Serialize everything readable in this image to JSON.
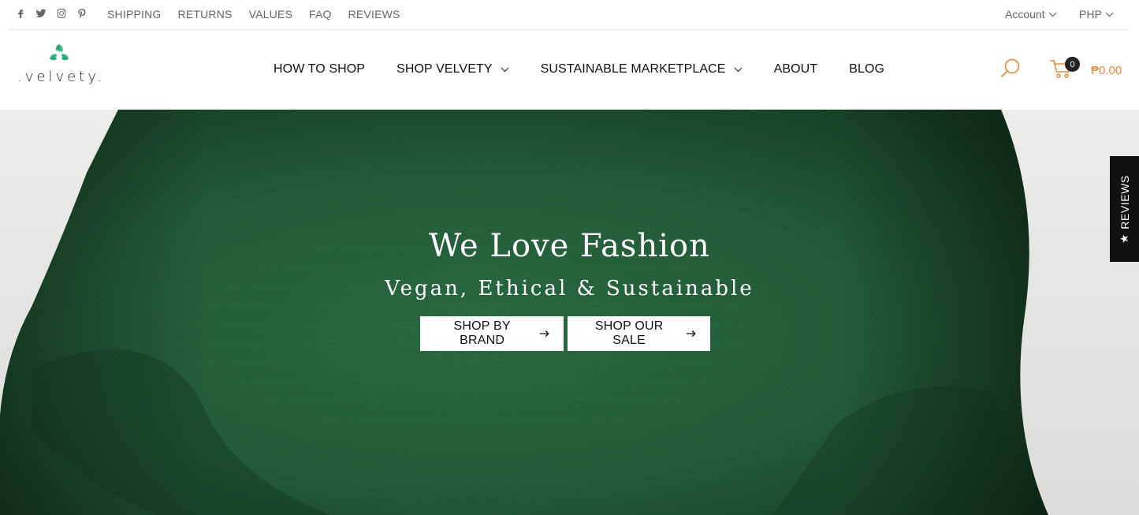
{
  "topbar": {
    "social": [
      "facebook-icon",
      "twitter-icon",
      "instagram-icon",
      "pinterest-icon"
    ],
    "links": [
      "SHIPPING",
      "RETURNS",
      "VALUES",
      "FAQ",
      "REVIEWS"
    ],
    "account_label": "Account",
    "currency_label": "PHP"
  },
  "header": {
    "logo_text": ".velvety.",
    "nav": [
      "HOW TO SHOP",
      "SHOP VELVETY",
      "SUSTAINABLE MARKETPLACE",
      "ABOUT",
      "BLOG"
    ],
    "cart_count": "0",
    "cart_total": "₱0.00",
    "accent_color": "#e8893a"
  },
  "hero": {
    "title": "We Love Fashion",
    "subtitle": "Vegan, Ethical & Sustainable",
    "buttons": [
      "SHOP BY BRAND",
      "SHOP OUR SALE"
    ]
  },
  "reviews_tab": {
    "label": "REVIEWS",
    "star": "★"
  }
}
